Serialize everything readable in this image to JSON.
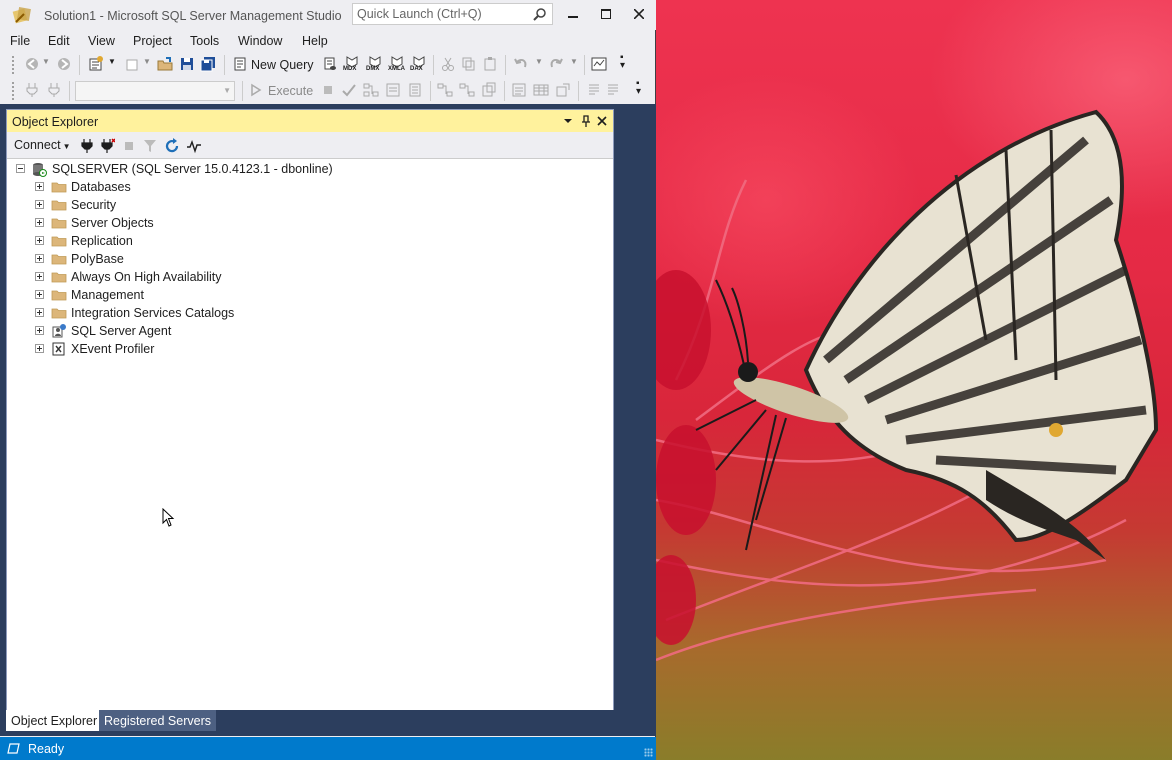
{
  "window": {
    "title": "Solution1 - Microsoft SQL Server Management Studio",
    "quick_launch_placeholder": "Quick Launch (Ctrl+Q)"
  },
  "menu": [
    "File",
    "Edit",
    "View",
    "Project",
    "Tools",
    "Window",
    "Help"
  ],
  "toolbar1": {
    "new_query_label": "New Query",
    "query_type_icons": [
      "MDX",
      "DMX",
      "XMLA",
      "DAX"
    ]
  },
  "toolbar2": {
    "database_combo_value": "",
    "execute_label": "Execute"
  },
  "object_explorer": {
    "title": "Object Explorer",
    "connect_label": "Connect",
    "server_node": "SQLSERVER (SQL Server 15.0.4123.1 - dbonline)",
    "nodes": [
      {
        "label": "Databases",
        "icon": "folder-icon"
      },
      {
        "label": "Security",
        "icon": "folder-icon"
      },
      {
        "label": "Server Objects",
        "icon": "folder-icon"
      },
      {
        "label": "Replication",
        "icon": "folder-icon"
      },
      {
        "label": "PolyBase",
        "icon": "folder-icon"
      },
      {
        "label": "Always On High Availability",
        "icon": "folder-icon"
      },
      {
        "label": "Management",
        "icon": "folder-icon"
      },
      {
        "label": "Integration Services Catalogs",
        "icon": "folder-icon"
      },
      {
        "label": "SQL Server Agent",
        "icon": "sql-agent-icon"
      },
      {
        "label": "XEvent Profiler",
        "icon": "xevent-icon"
      }
    ]
  },
  "bottom_tabs": [
    {
      "label": "Object Explorer",
      "active": true
    },
    {
      "label": "Registered Servers",
      "active": false
    }
  ],
  "status": {
    "text": "Ready"
  },
  "colors": {
    "accent": "#007acc",
    "dock_background": "#2c3e5e",
    "panel_header": "#fff29d",
    "folder": "#dcb67a"
  }
}
